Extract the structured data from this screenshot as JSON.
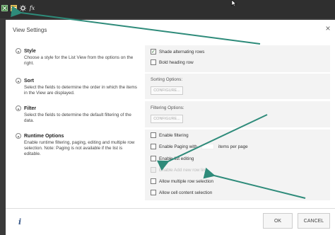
{
  "toolbar": {
    "icons": [
      "excel-icon",
      "data-icon",
      "settings-icon",
      "formula-icon"
    ],
    "fx_label": "fx"
  },
  "dialog": {
    "title": "View Settings",
    "close_glyph": "×",
    "sections": [
      {
        "title": "Style",
        "desc": "Choose a style for the List View from the options on the right."
      },
      {
        "title": "Sort",
        "desc": "Select the fields to determine the order in which the items in the View are displayed."
      },
      {
        "title": "Filter",
        "desc": "Select the fields to determine the default filtering of the data."
      },
      {
        "title": "Runtime Options",
        "desc": "Enable runtime filtering, paging, editing and multiple row selection. Note: Paging is not available if the list is editable."
      }
    ],
    "style_options": [
      {
        "label": "Shade alternating rows",
        "checked": true
      },
      {
        "label": "Bold heading row",
        "checked": false
      }
    ],
    "sort": {
      "label": "Sorting Options:",
      "button": "CONFIGURE..."
    },
    "filter": {
      "label": "Filtering Options:",
      "button": "CONFIGURE..."
    },
    "runtime_options": [
      {
        "label": "Enable filtering",
        "checked": false,
        "disabled": false
      },
      {
        "label": "Enable Paging with",
        "suffix": "items per page",
        "checked": false,
        "disabled": false
      },
      {
        "label": "Enable list editing",
        "checked": false,
        "disabled": false
      },
      {
        "label": "Enable Add new row link",
        "checked": false,
        "disabled": true
      },
      {
        "label": "Allow multiple row selection",
        "checked": false,
        "disabled": false
      },
      {
        "label": "Allow cell content selection",
        "checked": false,
        "disabled": false
      }
    ],
    "footer": {
      "info_glyph": "i",
      "ok_label": "OK",
      "cancel_label": "CANCEL"
    }
  },
  "annotation_color": "#2e8b7a"
}
